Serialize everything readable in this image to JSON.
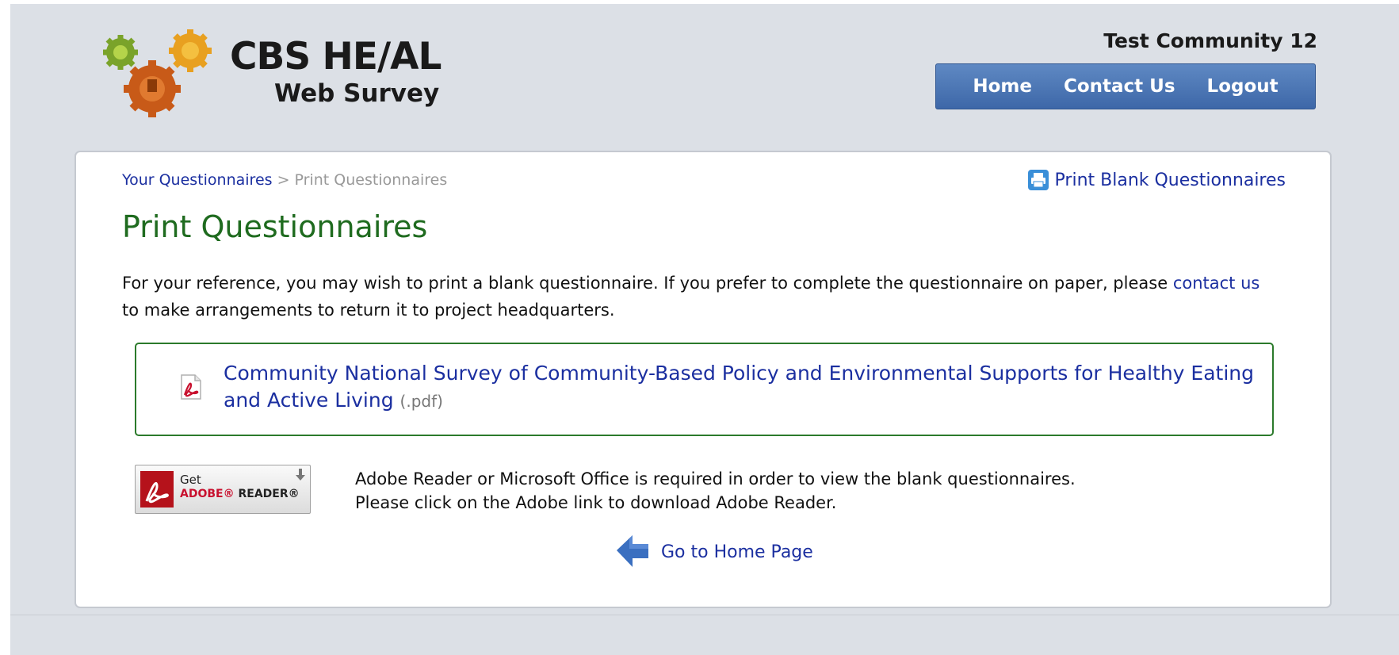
{
  "header": {
    "logo_title": "CBS HE/AL",
    "logo_subtitle": "Web Survey",
    "community_name": "Test Community 12",
    "nav": [
      "Home",
      "Contact Us",
      "Logout"
    ]
  },
  "breadcrumb": {
    "parent": "Your Questionnaires",
    "separator": ">",
    "current": "Print Questionnaires"
  },
  "print_blank_label": "Print Blank Questionnaires",
  "page_title": "Print Questionnaires",
  "intro": {
    "before_link": "For your reference, you may wish to print a blank questionnaire. If you prefer to complete the questionnaire on paper, please",
    "link": "contact us",
    "after_link": "to make arrangements to return it to project headquarters."
  },
  "document": {
    "title": "Community National Survey of Community-Based Policy and Environmental Supports for Healthy Eating and Active Living",
    "ext": "(.pdf)"
  },
  "adobe": {
    "get": "Get",
    "brand": "ADOBE® ",
    "product": "READER®"
  },
  "requirements": [
    "Adobe Reader or Microsoft Office is required in order to view the blank questionnaires.",
    "Please click on the Adobe link to download Adobe Reader."
  ],
  "home_link_label": "Go to Home Page",
  "colors": {
    "page_bg": "#dce0e6",
    "nav_bar": "#4a74b4",
    "link": "#1b2fa0",
    "title_green": "#1f6b1f",
    "box_border": "#2b7a2b"
  },
  "icons": [
    "logo-gears-icon",
    "printer-icon",
    "pdf-icon",
    "adobe-reader-icon",
    "download-arrow-icon",
    "back-arrow-icon"
  ]
}
